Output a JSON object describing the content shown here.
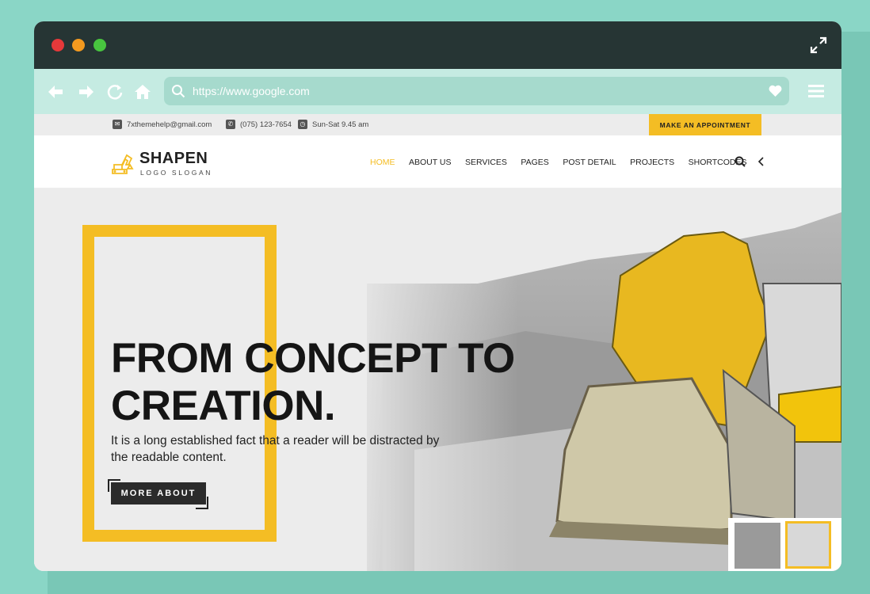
{
  "browser": {
    "url": "https://www.google.com",
    "icons": [
      "back-arrow-icon",
      "forward-arrow-icon",
      "refresh-icon",
      "home-icon",
      "search-icon",
      "heart-icon",
      "hamburger-menu-icon",
      "expand-icon"
    ]
  },
  "topbar": {
    "email": "7xthemehelp@gmail.com",
    "phone": "(075) 123-7654",
    "hours": "Sun-Sat 9.45 am",
    "appointment_label": "MAKE AN APPOINTMENT"
  },
  "header": {
    "logo_name": "SHAPEN",
    "logo_slogan": "LOGO SLOGAN",
    "nav": [
      {
        "label": "HOME",
        "active": true
      },
      {
        "label": "ABOUT US"
      },
      {
        "label": "SERVICES"
      },
      {
        "label": "PAGES"
      },
      {
        "label": "POST DETAIL"
      },
      {
        "label": "PROJECTS"
      },
      {
        "label": "SHORTCODES"
      }
    ]
  },
  "hero": {
    "title": "FROM CONCEPT TO\nCREATION.",
    "text": "It is a long established fact that a reader will be distracted by the readable content.",
    "button_label": "MORE ABOUT"
  },
  "colors": {
    "accent": "#f4bd24",
    "titlebar": "#263534",
    "toolbar": "#c5ebe2",
    "background": "#8ad6c6"
  }
}
